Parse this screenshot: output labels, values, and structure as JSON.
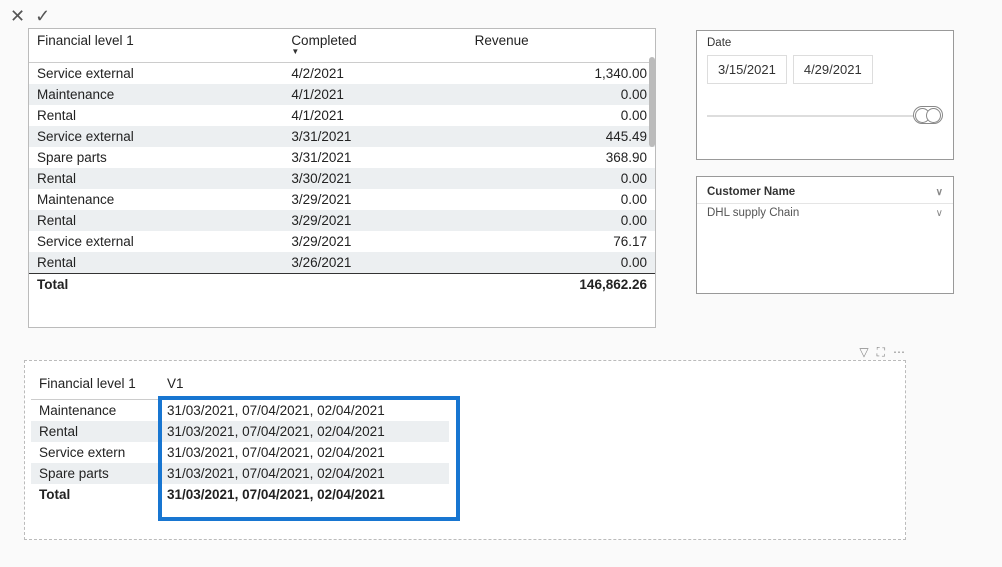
{
  "topbar": {
    "close": "✕",
    "check": "✓"
  },
  "table1": {
    "headers": [
      "Financial level 1",
      "Completed",
      "Revenue"
    ],
    "rows": [
      {
        "c0": "Service external",
        "c1": "4/2/2021",
        "c2": "1,340.00"
      },
      {
        "c0": "Maintenance",
        "c1": "4/1/2021",
        "c2": "0.00"
      },
      {
        "c0": "Rental",
        "c1": "4/1/2021",
        "c2": "0.00"
      },
      {
        "c0": "Service external",
        "c1": "3/31/2021",
        "c2": "445.49"
      },
      {
        "c0": "Spare parts",
        "c1": "3/31/2021",
        "c2": "368.90"
      },
      {
        "c0": "Rental",
        "c1": "3/30/2021",
        "c2": "0.00"
      },
      {
        "c0": "Maintenance",
        "c1": "3/29/2021",
        "c2": "0.00"
      },
      {
        "c0": "Rental",
        "c1": "3/29/2021",
        "c2": "0.00"
      },
      {
        "c0": "Service external",
        "c1": "3/29/2021",
        "c2": "76.17"
      },
      {
        "c0": "Rental",
        "c1": "3/26/2021",
        "c2": "0.00"
      }
    ],
    "total_label": "Total",
    "total_value": "146,862.26"
  },
  "date_slicer": {
    "label": "Date",
    "from": "3/15/2021",
    "to": "4/29/2021"
  },
  "customer_slicer": {
    "label": "Customer Name",
    "selected": "DHL supply Chain"
  },
  "table2": {
    "headers": [
      "Financial level 1",
      "V1"
    ],
    "rows": [
      {
        "c0": "Maintenance",
        "c1": "31/03/2021, 07/04/2021, 02/04/2021"
      },
      {
        "c0": "Rental",
        "c1": "31/03/2021, 07/04/2021, 02/04/2021"
      },
      {
        "c0": "Service extern",
        "c1": "31/03/2021, 07/04/2021, 02/04/2021"
      },
      {
        "c0": "Spare parts",
        "c1": "31/03/2021, 07/04/2021, 02/04/2021"
      }
    ],
    "total_label": "Total",
    "total_value": "31/03/2021, 07/04/2021, 02/04/2021"
  }
}
